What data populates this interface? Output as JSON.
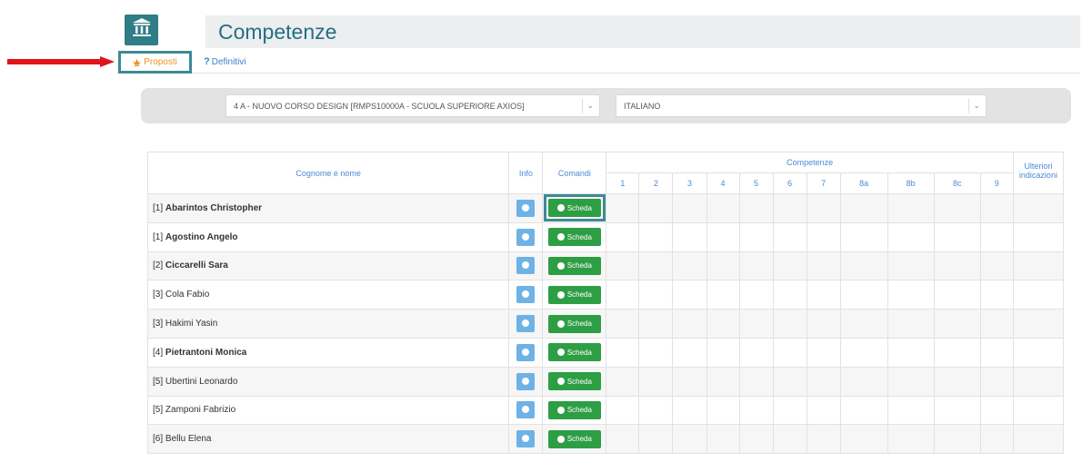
{
  "header": {
    "title": "Competenze",
    "logo_icon": "building-icon"
  },
  "tabs": [
    {
      "label": "Proposti",
      "icon": "crown-icon",
      "active": true
    },
    {
      "label": "Definitivi",
      "icon": "question-icon",
      "active": false
    }
  ],
  "filters": {
    "class_select": "4 A - NUOVO CORSO DESIGN [RMPS10000A - SCUOLA SUPERIORE AXIOS]",
    "subject_select": "ITALIANO"
  },
  "table": {
    "headers": {
      "name": "Cognome e nome",
      "info": "Info",
      "commands": "Comandi",
      "competences": "Competenze",
      "further": "Ulteriori indicazioni"
    },
    "competence_columns": [
      "1",
      "2",
      "3",
      "4",
      "5",
      "6",
      "7",
      "8a",
      "8b",
      "8c",
      "9"
    ],
    "button_label": "Scheda",
    "rows": [
      {
        "prefix": "[1]",
        "name": "Abarintos Christopher",
        "bold": true
      },
      {
        "prefix": "[1]",
        "name": "Agostino Angelo",
        "bold": true
      },
      {
        "prefix": "[2]",
        "name": "Ciccarelli Sara",
        "bold": true
      },
      {
        "prefix": "[3]",
        "name": "Cola Fabio",
        "bold": false
      },
      {
        "prefix": "[3]",
        "name": "Hakimi Yasin",
        "bold": false
      },
      {
        "prefix": "[4]",
        "name": "Pietrantoni Monica",
        "bold": true
      },
      {
        "prefix": "[5]",
        "name": "Ubertini Leonardo",
        "bold": false
      },
      {
        "prefix": "[5]",
        "name": "Zamponi Fabrizio",
        "bold": false
      },
      {
        "prefix": "[6]",
        "name": "Bellu Elena",
        "bold": false
      }
    ]
  },
  "colors": {
    "accent": "#256f83",
    "highlight_border": "#3e8a95",
    "button_green": "#2e9e44",
    "info_blue": "#6fb2e6",
    "arrow_red": "#e0141b",
    "tab_orange": "#f0931d"
  }
}
